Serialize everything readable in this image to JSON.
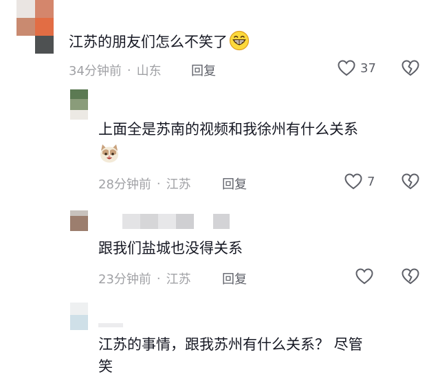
{
  "comments": [
    {
      "text": "江苏的朋友们怎么不笑了",
      "emoji": "grinning-face",
      "time": "34分钟前",
      "location": "山东",
      "reply_label": "回复",
      "likes": "37"
    },
    {
      "text": "上面全是苏南的视频和我徐州有什么关系",
      "emoji": "cat-face",
      "time": "28分钟前",
      "location": "江苏",
      "reply_label": "回复",
      "likes": "7"
    },
    {
      "text": "跟我们盐城也没得关系",
      "time": "23分钟前",
      "location": "江苏",
      "reply_label": "回复",
      "likes": ""
    },
    {
      "text_line1": "江苏的事情，跟我苏州有什么关系？ 尽管",
      "text_line2": "笑"
    }
  ],
  "colors": {
    "text": "#161823",
    "meta": "#a0a1a5",
    "icon": "#5e6068"
  },
  "icons": [
    "heart-outline-icon",
    "broken-heart-icon",
    "grinning-face-emoji",
    "cat-face-emoji"
  ]
}
